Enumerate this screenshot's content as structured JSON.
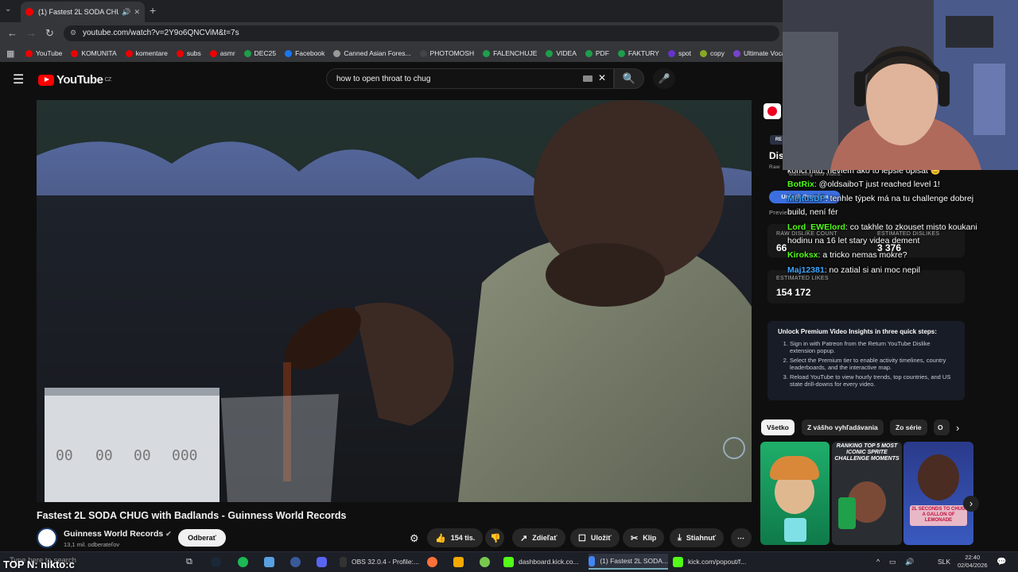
{
  "browser": {
    "tab_title": "(1) Fastest 2L SODA CHUG w",
    "url": "youtube.com/watch?v=2Y9o6QNCViM&t=7s",
    "bookmarks": [
      {
        "label": "YouTube",
        "color": "#e00"
      },
      {
        "label": "KOMUNITA",
        "color": "#e00"
      },
      {
        "label": "komentare",
        "color": "#e00"
      },
      {
        "label": "subs",
        "color": "#e00"
      },
      {
        "label": "asmr",
        "color": "#e00"
      },
      {
        "label": "DEC25",
        "color": "#1e9e4a"
      },
      {
        "label": "Facebook",
        "color": "#1877f2"
      },
      {
        "label": "Canned Asian Fores...",
        "color": "#999"
      },
      {
        "label": "PHOTOMOSH",
        "color": "#444"
      },
      {
        "label": "FALENCHUJE",
        "color": "#1e9e4a"
      },
      {
        "label": "VIDEA",
        "color": "#1e9e4a"
      },
      {
        "label": "PDF",
        "color": "#1e9e4a"
      },
      {
        "label": "FAKTURY",
        "color": "#1e9e4a"
      },
      {
        "label": "spot",
        "color": "#6633cc"
      },
      {
        "label": "copy",
        "color": "#88aa22"
      },
      {
        "label": "Ultimate Vocal Rem...",
        "color": "#7744cc"
      }
    ]
  },
  "youtube": {
    "region": "CZ",
    "search_query": "how to open throat to chug",
    "video": {
      "timer": [
        "00",
        "00",
        "00",
        "000"
      ],
      "title": "Fastest 2L SODA CHUG with Badlands - Guinness World Records",
      "channel": "Guinness World Records",
      "subscribers": "13,1 mil. odberateľov",
      "subscribe_label": "Odberať",
      "likes": "154 tis.",
      "share_label": "Zdieľať",
      "save_label": "Uložiť",
      "clip_label": "Klip",
      "download_label": "Stiahnuť"
    },
    "dislike_panel": {
      "heading": "Dis",
      "raw_label": "RAW DISLIKE COUNT",
      "raw_value": "66",
      "est_dislikes_label": "ESTIMATED DISLIKES",
      "est_dislikes_value": "3 376",
      "est_likes_label": "ESTIMATED LIKES",
      "est_likes_value": "154 172",
      "unlock_label": "Unlock Premium",
      "preview_label": "Preview",
      "watching": "watching this video.",
      "premium_title": "Unlock Premium Video Insights in three quick steps:",
      "premium_steps": [
        "Sign in with Patreon from the Return YouTube Dislike extension popup.",
        "Select the Premium tier to enable activity timelines, country leaderboards, and the interactive map.",
        "Reload YouTube to view hourly trends, top countries, and US state drill-downs for every video."
      ]
    },
    "chips": [
      "Všetko",
      "Z vášho vyhľadávania",
      "Zo série",
      "O"
    ],
    "thumbs": [
      {
        "text": ""
      },
      {
        "text": "RANKING TOP 5 MOST ICONIC SPRITE CHALLENGE MOMENTS"
      },
      {
        "text": "2L SECONDS TO CHUG A GALLON OF LEMONADE"
      }
    ]
  },
  "chat": [
    {
      "user": "",
      "text": "konci hitu, neviem ako to lepsie opisat 😊",
      "color": "#fff"
    },
    {
      "user": "BotRix",
      "text": ": @oldsaiboT just reached level 1!",
      "color": "#53fc18"
    },
    {
      "user": "MejtusDP",
      "text": ": tenhle týpek má na tu challenge dobrej",
      "color": "#3ea6ff"
    },
    {
      "user": "",
      "text": "build, není fér",
      "color": "#fff"
    },
    {
      "user": "Lord_EWElord",
      "text": ": co takhle to zkouset misto koukani",
      "color": "#53fc18"
    },
    {
      "user": "",
      "text": "hodinu na 16 let stary videa dement",
      "color": "#fff"
    },
    {
      "user": "Kiroksx",
      "text": ": a tricko nemas mokre?",
      "color": "#53fc18"
    },
    {
      "user": "Maj12381",
      "text": ": no zatial si ani moc nepil",
      "color": "#3ea6ff"
    }
  ],
  "taskbar": {
    "search_placeholder": "Type here to search",
    "overlay": "TOP N: nikto:c",
    "apps": [
      {
        "label": "OBS 32.0.4 - Profile:...",
        "color": "#333"
      },
      {
        "label": "dashboard.kick.co...",
        "color": "#53fc18"
      },
      {
        "label": "(1) Fastest 2L SODA...",
        "color": "#4285f4"
      },
      {
        "label": "kick.com/popout/f...",
        "color": "#53fc18"
      }
    ],
    "lang": "SLK",
    "time": "22:40",
    "date": "02/04/2026"
  }
}
